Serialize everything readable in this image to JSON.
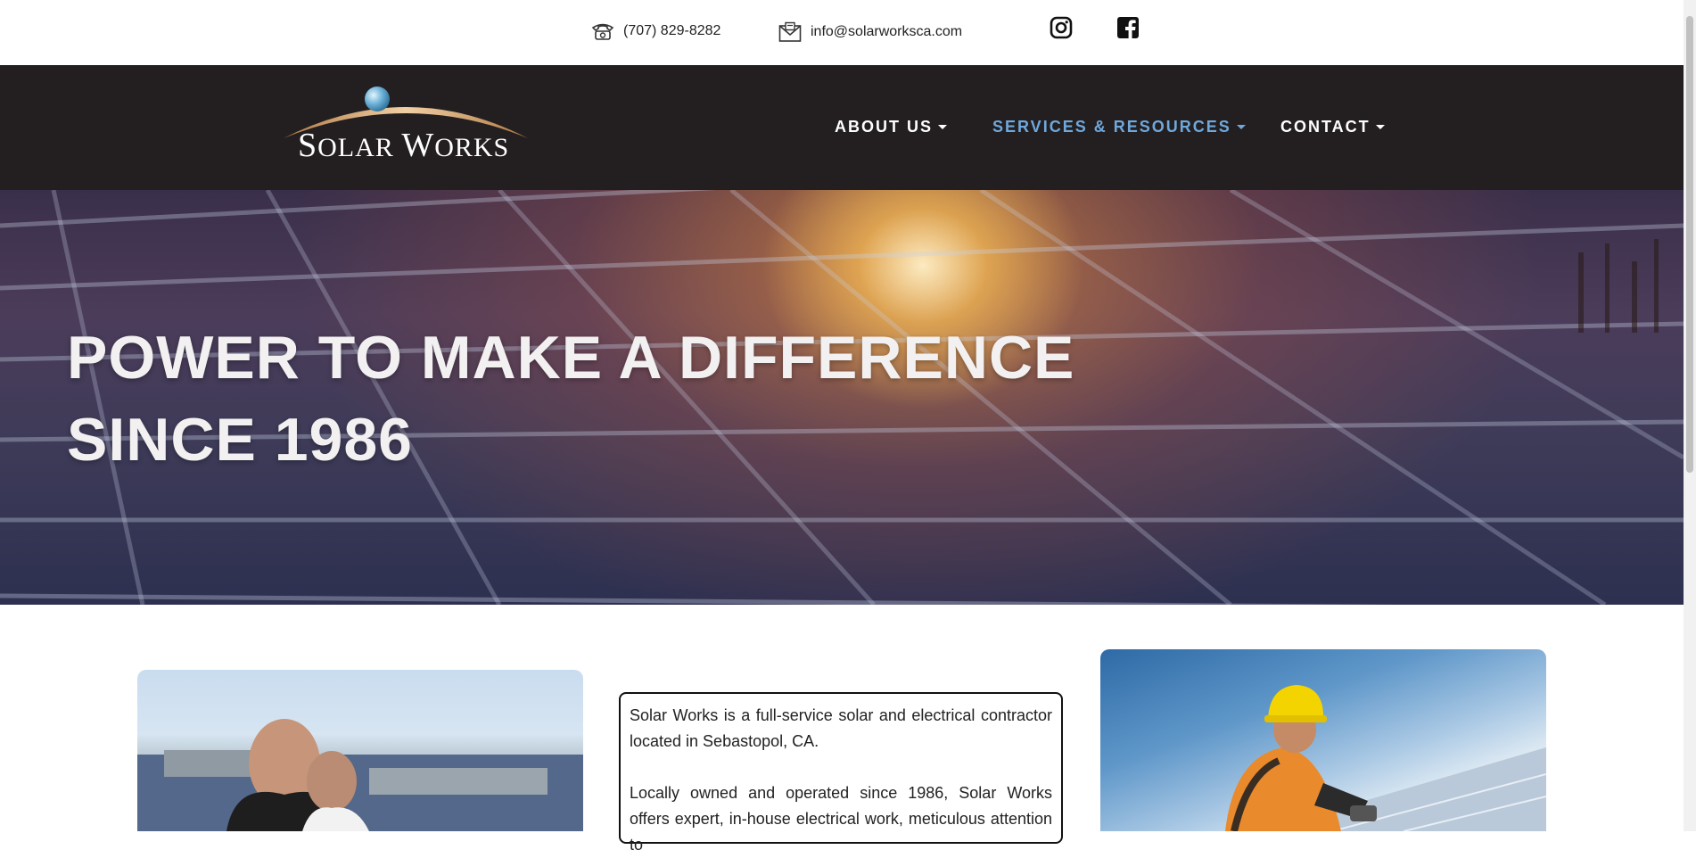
{
  "topbar": {
    "phone": "(707) 829-8282",
    "email": "info@solarworksca.com",
    "social_icons": [
      "instagram-icon",
      "facebook-icon"
    ]
  },
  "brand": {
    "logo_part1": "S",
    "logo_part2": "OLAR ",
    "logo_part3": "W",
    "logo_part4": "ORKS"
  },
  "nav": {
    "items": [
      {
        "label": "ABOUT US"
      },
      {
        "label": "SERVICES & RESOURCES"
      },
      {
        "label": "CONTACT"
      }
    ],
    "active_color": "#6fa8dc"
  },
  "hero": {
    "line1": "POWER TO MAKE A DIFFERENCE",
    "line2": "SINCE 1986"
  },
  "intro": {
    "p1": "Solar Works is a full-service solar and electrical contractor located in Sebastopol, CA.",
    "p2": "Locally owned and operated since 1986, Solar Works offers expert, in-house electrical work, meticulous attention to"
  },
  "colors": {
    "navbar_bg": "#231f20",
    "logo_arc": "#d9a36b",
    "logo_orb": "#6fb3d9"
  }
}
